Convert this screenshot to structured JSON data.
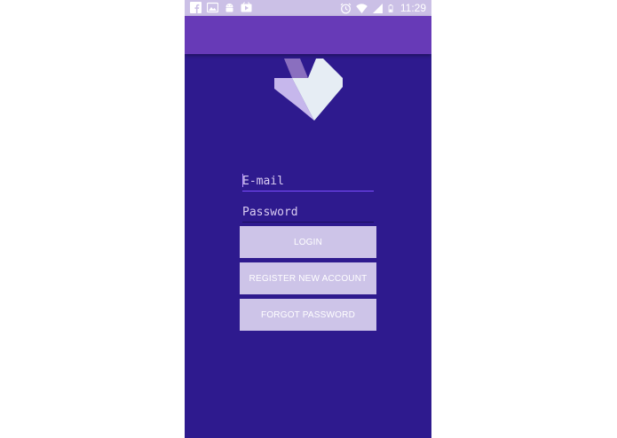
{
  "status_bar": {
    "left_icons": [
      "facebook-icon",
      "image-icon",
      "android-icon",
      "media-icon"
    ],
    "right_icons": [
      "alarm-icon",
      "wifi-icon",
      "signal-icon",
      "battery-icon"
    ],
    "time": "11:29"
  },
  "login": {
    "email_placeholder": "E-mail",
    "email_value": "",
    "password_placeholder": "Password",
    "password_value": "",
    "login_label": "LOGIN",
    "register_label": "REGISTER NEW ACCOUNT",
    "forgot_label": "FORGOT PASSWORD"
  },
  "colors": {
    "background": "#2e1a8e",
    "app_bar": "#673ab7",
    "status_bar": "#cbc0e6",
    "button": "#cdc4e8",
    "accent": "#7c4dff"
  }
}
